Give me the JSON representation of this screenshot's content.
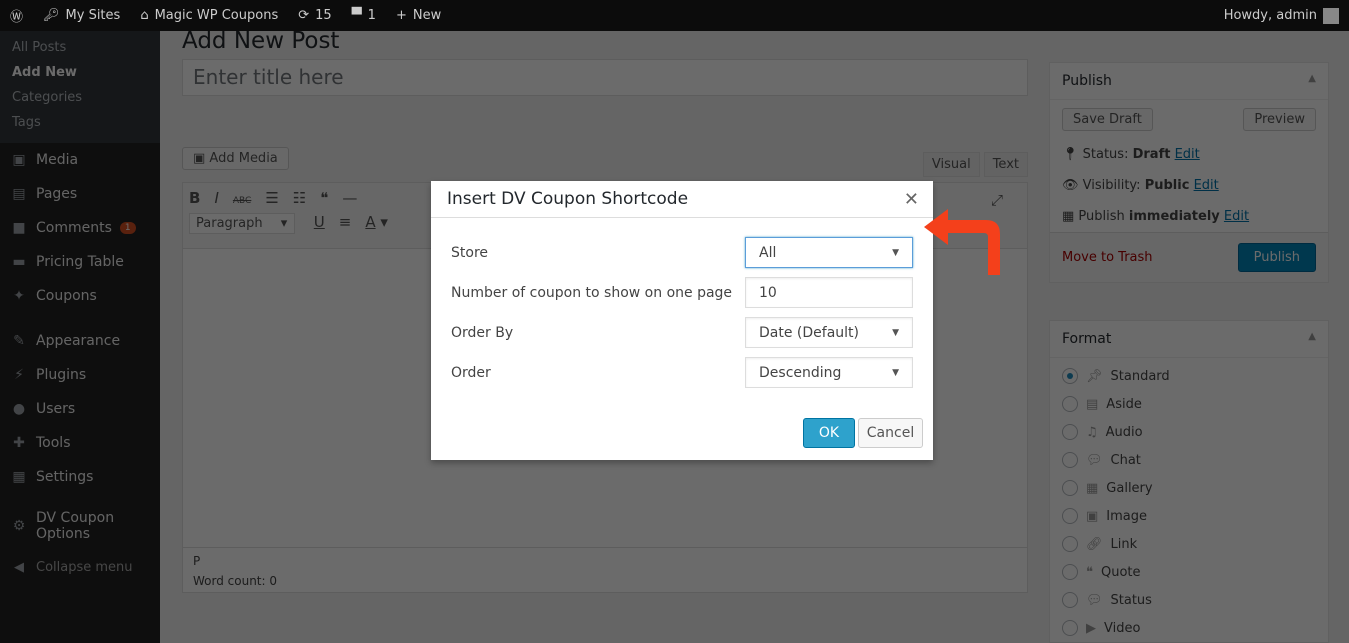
{
  "adminbar": {
    "my_sites": "My Sites",
    "site": "Magic WP Coupons",
    "updates": "15",
    "comments": "1",
    "new": "New",
    "howdy": "Howdy, admin"
  },
  "sidebar": {
    "sub": [
      "All Posts",
      "Add New",
      "Categories",
      "Tags"
    ],
    "items": [
      {
        "label": "Media",
        "icon": "▣"
      },
      {
        "label": "Pages",
        "icon": "▤"
      },
      {
        "label": "Comments",
        "icon": "■",
        "badge": "1"
      },
      {
        "label": "Pricing Table",
        "icon": "▬"
      },
      {
        "label": "Coupons",
        "icon": "✦"
      },
      {
        "label": "Appearance",
        "icon": "✎"
      },
      {
        "label": "Plugins",
        "icon": "⚡"
      },
      {
        "label": "Users",
        "icon": "●"
      },
      {
        "label": "Tools",
        "icon": "✚"
      },
      {
        "label": "Settings",
        "icon": "▦"
      }
    ],
    "dv1": "DV Coupon",
    "dv2": "Options",
    "collapse": "Collapse menu"
  },
  "main": {
    "heading": "Add New Post",
    "title_placeholder": "Enter title here",
    "add_media": "Add Media",
    "tab_visual": "Visual",
    "tab_text": "Text",
    "paragraph": "Paragraph",
    "path": "P",
    "word_count": "Word count: 0"
  },
  "publish": {
    "title": "Publish",
    "save_draft": "Save Draft",
    "preview": "Preview",
    "status_label": "Status:",
    "status": "Draft",
    "visibility_label": "Visibility:",
    "visibility": "Public",
    "publish_label": "Publish",
    "publish_when": "immediately",
    "edit": "Edit",
    "trash": "Move to Trash",
    "publish_btn": "Publish"
  },
  "format": {
    "title": "Format",
    "options": [
      "Standard",
      "Aside",
      "Audio",
      "Chat",
      "Gallery",
      "Image",
      "Link",
      "Quote",
      "Status",
      "Video"
    ]
  },
  "dialog": {
    "title": "Insert DV Coupon Shortcode",
    "store_label": "Store",
    "store": "All",
    "num_label": "Number of coupon to show on one page",
    "num": "10",
    "orderby_label": "Order By",
    "orderby": "Date (Default)",
    "order_label": "Order",
    "order": "Descending",
    "ok": "OK",
    "cancel": "Cancel"
  },
  "colors": {
    "accent": "#2ea2cc",
    "arrow": "#f4401b"
  }
}
